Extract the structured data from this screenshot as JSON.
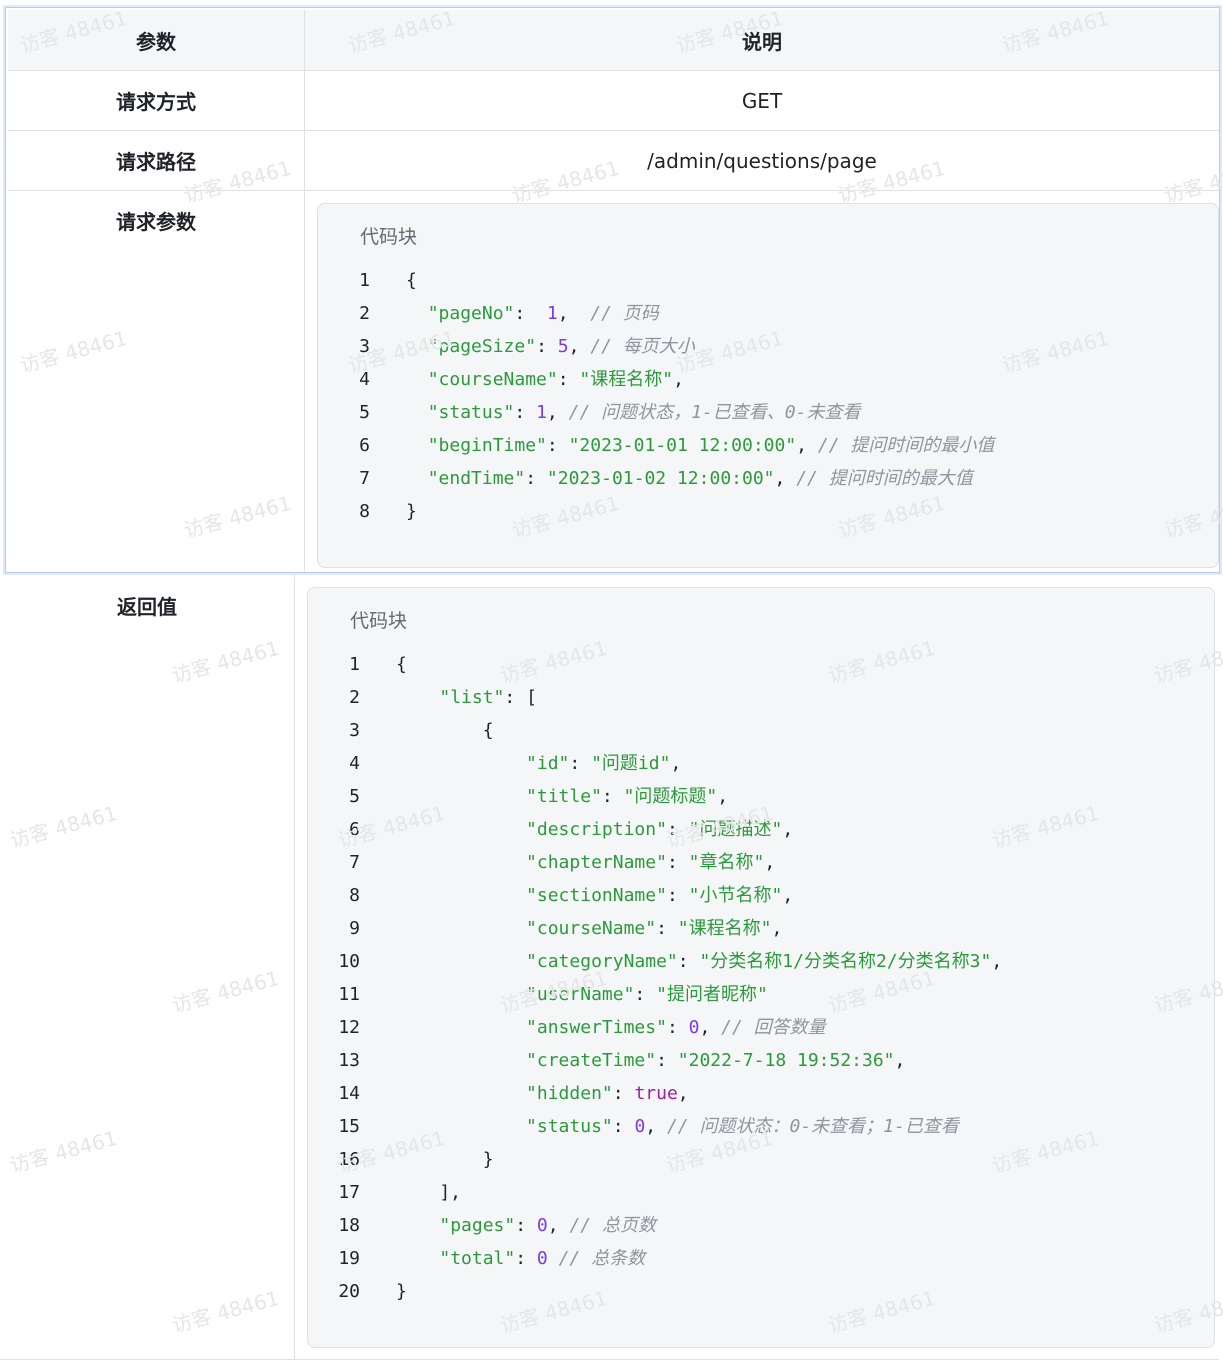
{
  "table": {
    "header": {
      "param": "参数",
      "desc": "说明"
    },
    "method": {
      "label": "请求方式",
      "value": "GET"
    },
    "path": {
      "label": "请求路径",
      "value": "/admin/questions/page"
    },
    "params": {
      "label": "请求参数"
    },
    "returns": {
      "label": "返回值"
    }
  },
  "request_block": {
    "title": "代码块",
    "lines": [
      {
        "n": "1",
        "tokens": [
          {
            "t": "{",
            "c": "p"
          }
        ]
      },
      {
        "n": "2",
        "tokens": [
          {
            "t": "  ",
            "c": "p"
          },
          {
            "t": "\"pageNo\"",
            "c": "key"
          },
          {
            "t": ":  ",
            "c": "p"
          },
          {
            "t": "1",
            "c": "num"
          },
          {
            "t": ",  ",
            "c": "p"
          },
          {
            "t": "// 页码",
            "c": "cmt"
          }
        ]
      },
      {
        "n": "3",
        "tokens": [
          {
            "t": "  ",
            "c": "p"
          },
          {
            "t": "\"pageSize\"",
            "c": "key"
          },
          {
            "t": ": ",
            "c": "p"
          },
          {
            "t": "5",
            "c": "num"
          },
          {
            "t": ", ",
            "c": "p"
          },
          {
            "t": "// 每页大小",
            "c": "cmt"
          }
        ]
      },
      {
        "n": "4",
        "tokens": [
          {
            "t": "  ",
            "c": "p"
          },
          {
            "t": "\"courseName\"",
            "c": "key"
          },
          {
            "t": ": ",
            "c": "p"
          },
          {
            "t": "\"课程名称\"",
            "c": "str"
          },
          {
            "t": ",",
            "c": "p"
          }
        ]
      },
      {
        "n": "5",
        "tokens": [
          {
            "t": "  ",
            "c": "p"
          },
          {
            "t": "\"status\"",
            "c": "key"
          },
          {
            "t": ": ",
            "c": "p"
          },
          {
            "t": "1",
            "c": "num"
          },
          {
            "t": ", ",
            "c": "p"
          },
          {
            "t": "// 问题状态，1-已查看、0-未查看",
            "c": "cmt"
          }
        ]
      },
      {
        "n": "6",
        "tokens": [
          {
            "t": "  ",
            "c": "p"
          },
          {
            "t": "\"beginTime\"",
            "c": "key"
          },
          {
            "t": ": ",
            "c": "p"
          },
          {
            "t": "\"2023-01-01 12:00:00\"",
            "c": "str"
          },
          {
            "t": ", ",
            "c": "p"
          },
          {
            "t": "// 提问时间的最小值",
            "c": "cmt"
          }
        ]
      },
      {
        "n": "7",
        "tokens": [
          {
            "t": "  ",
            "c": "p"
          },
          {
            "t": "\"endTime\"",
            "c": "key"
          },
          {
            "t": ": ",
            "c": "p"
          },
          {
            "t": "\"2023-01-02 12:00:00\"",
            "c": "str"
          },
          {
            "t": ", ",
            "c": "p"
          },
          {
            "t": "// 提问时间的最大值",
            "c": "cmt"
          }
        ]
      },
      {
        "n": "8",
        "tokens": [
          {
            "t": "}",
            "c": "p"
          }
        ]
      }
    ]
  },
  "response_block": {
    "title": "代码块",
    "lines": [
      {
        "n": "1",
        "tokens": [
          {
            "t": "{",
            "c": "p"
          }
        ]
      },
      {
        "n": "2",
        "tokens": [
          {
            "t": "    ",
            "c": "p"
          },
          {
            "t": "\"list\"",
            "c": "key"
          },
          {
            "t": ": [",
            "c": "p"
          }
        ]
      },
      {
        "n": "3",
        "tokens": [
          {
            "t": "        {",
            "c": "p"
          }
        ]
      },
      {
        "n": "4",
        "tokens": [
          {
            "t": "            ",
            "c": "p"
          },
          {
            "t": "\"id\"",
            "c": "key"
          },
          {
            "t": ": ",
            "c": "p"
          },
          {
            "t": "\"问题id\"",
            "c": "str"
          },
          {
            "t": ",",
            "c": "p"
          }
        ]
      },
      {
        "n": "5",
        "tokens": [
          {
            "t": "            ",
            "c": "p"
          },
          {
            "t": "\"title\"",
            "c": "key"
          },
          {
            "t": ": ",
            "c": "p"
          },
          {
            "t": "\"问题标题\"",
            "c": "str"
          },
          {
            "t": ",",
            "c": "p"
          }
        ]
      },
      {
        "n": "6",
        "tokens": [
          {
            "t": "            ",
            "c": "p"
          },
          {
            "t": "\"description\"",
            "c": "key"
          },
          {
            "t": ": ",
            "c": "p"
          },
          {
            "t": "\"问题描述\"",
            "c": "str"
          },
          {
            "t": ",",
            "c": "p"
          }
        ]
      },
      {
        "n": "7",
        "tokens": [
          {
            "t": "            ",
            "c": "p"
          },
          {
            "t": "\"chapterName\"",
            "c": "key"
          },
          {
            "t": ": ",
            "c": "p"
          },
          {
            "t": "\"章名称\"",
            "c": "str"
          },
          {
            "t": ",",
            "c": "p"
          }
        ]
      },
      {
        "n": "8",
        "tokens": [
          {
            "t": "            ",
            "c": "p"
          },
          {
            "t": "\"sectionName\"",
            "c": "key"
          },
          {
            "t": ": ",
            "c": "p"
          },
          {
            "t": "\"小节名称\"",
            "c": "str"
          },
          {
            "t": ",",
            "c": "p"
          }
        ]
      },
      {
        "n": "9",
        "tokens": [
          {
            "t": "            ",
            "c": "p"
          },
          {
            "t": "\"courseName\"",
            "c": "key"
          },
          {
            "t": ": ",
            "c": "p"
          },
          {
            "t": "\"课程名称\"",
            "c": "str"
          },
          {
            "t": ",",
            "c": "p"
          }
        ]
      },
      {
        "n": "10",
        "tokens": [
          {
            "t": "            ",
            "c": "p"
          },
          {
            "t": "\"categoryName\"",
            "c": "key"
          },
          {
            "t": ": ",
            "c": "p"
          },
          {
            "t": "\"分类名称1/分类名称2/分类名称3\"",
            "c": "str"
          },
          {
            "t": ",",
            "c": "p"
          }
        ]
      },
      {
        "n": "11",
        "tokens": [
          {
            "t": "            ",
            "c": "p"
          },
          {
            "t": "\"userName\"",
            "c": "key"
          },
          {
            "t": ": ",
            "c": "p"
          },
          {
            "t": "\"提问者昵称\"",
            "c": "str"
          }
        ]
      },
      {
        "n": "12",
        "tokens": [
          {
            "t": "            ",
            "c": "p"
          },
          {
            "t": "\"answerTimes\"",
            "c": "key"
          },
          {
            "t": ": ",
            "c": "p"
          },
          {
            "t": "0",
            "c": "num"
          },
          {
            "t": ", ",
            "c": "p"
          },
          {
            "t": "// 回答数量",
            "c": "cmt"
          }
        ]
      },
      {
        "n": "13",
        "tokens": [
          {
            "t": "            ",
            "c": "p"
          },
          {
            "t": "\"createTime\"",
            "c": "key"
          },
          {
            "t": ": ",
            "c": "p"
          },
          {
            "t": "\"2022-7-18 19:52:36\"",
            "c": "str"
          },
          {
            "t": ",",
            "c": "p"
          }
        ]
      },
      {
        "n": "14",
        "tokens": [
          {
            "t": "            ",
            "c": "p"
          },
          {
            "t": "\"hidden\"",
            "c": "key"
          },
          {
            "t": ": ",
            "c": "p"
          },
          {
            "t": "true",
            "c": "kw"
          },
          {
            "t": ",",
            "c": "p"
          }
        ]
      },
      {
        "n": "15",
        "tokens": [
          {
            "t": "            ",
            "c": "p"
          },
          {
            "t": "\"status\"",
            "c": "key"
          },
          {
            "t": ": ",
            "c": "p"
          },
          {
            "t": "0",
            "c": "num"
          },
          {
            "t": ", ",
            "c": "p"
          },
          {
            "t": "// 问题状态：0-未查看；1-已查看",
            "c": "cmt"
          }
        ]
      },
      {
        "n": "16",
        "tokens": [
          {
            "t": "        }",
            "c": "p"
          }
        ]
      },
      {
        "n": "17",
        "tokens": [
          {
            "t": "    ],",
            "c": "p"
          }
        ]
      },
      {
        "n": "18",
        "tokens": [
          {
            "t": "    ",
            "c": "p"
          },
          {
            "t": "\"pages\"",
            "c": "key"
          },
          {
            "t": ": ",
            "c": "p"
          },
          {
            "t": "0",
            "c": "num"
          },
          {
            "t": ", ",
            "c": "p"
          },
          {
            "t": "// 总页数",
            "c": "cmt"
          }
        ]
      },
      {
        "n": "19",
        "tokens": [
          {
            "t": "    ",
            "c": "p"
          },
          {
            "t": "\"total\"",
            "c": "key"
          },
          {
            "t": ": ",
            "c": "p"
          },
          {
            "t": "0",
            "c": "num"
          },
          {
            "t": " ",
            "c": "p"
          },
          {
            "t": "// 总条数",
            "c": "cmt"
          }
        ]
      },
      {
        "n": "20",
        "tokens": [
          {
            "t": "}",
            "c": "p"
          }
        ]
      }
    ]
  },
  "watermark": {
    "text": "访客 48461"
  },
  "colors": {
    "key": "#2c9a3c",
    "number": "#7c3aed",
    "keyword": "#9a1ea8",
    "comment": "#8f959e",
    "border": "#dee0e3",
    "selection": "#b7ccf0"
  }
}
